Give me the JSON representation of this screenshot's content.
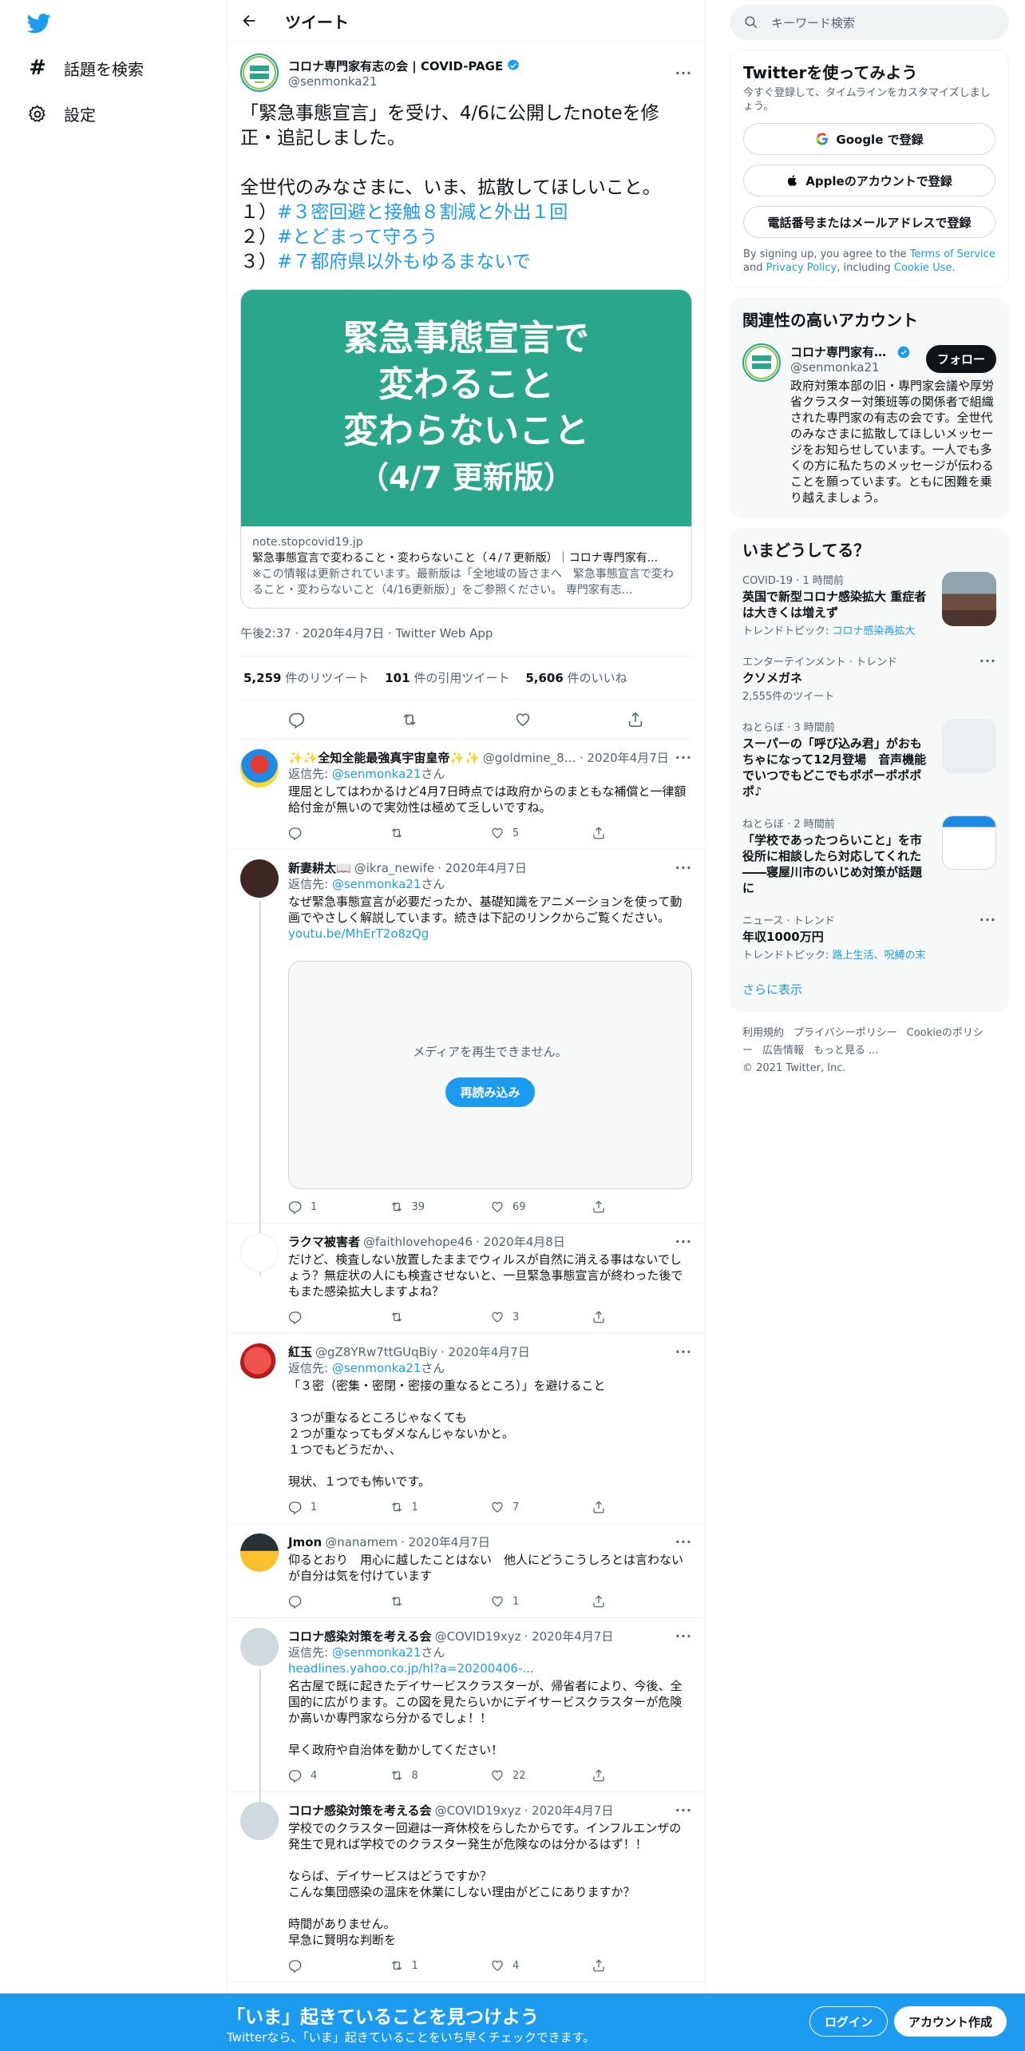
{
  "nav": {
    "explore_label": "話題を検索",
    "settings_label": "設定"
  },
  "header": {
    "title": "ツイート"
  },
  "main_tweet": {
    "author_name": "コロナ専門家有志の会 | COVID-PAGE",
    "handle": "@senmonka21",
    "avatar_text": "コロナ専門家",
    "text_intro": "「緊急事態宣言」を受け、4/6に公開したnoteを修正・追記しました。\n\n全世代のみなさまに、いま、拡散してほしいこと。\n",
    "points": [
      {
        "num": "１）",
        "tag": "#３密回避と接触８割減と外出１回"
      },
      {
        "num": "２）",
        "tag": "#とどまって守ろう"
      },
      {
        "num": "３）",
        "tag": "#７都府県以外もゆるまないで"
      }
    ],
    "card": {
      "image_line1": "緊急事態宣言で",
      "image_line2": "変わること",
      "image_line3": "変わらないこと",
      "image_line4": "（4/7 更新版）",
      "domain": "note.stopcovid19.jp",
      "title": "緊急事態宣言で変わること・変わらないこと（４/７更新版）｜コロナ専門家有...",
      "description": "※この情報は更新されています。最新版は「全地域の皆さまへ　緊急事態宣言で変わること・変わらないこと（4/16更新版）」をご参照ください。 専門家有志..."
    },
    "meta": "午後2:37 · 2020年4月7日 · Twitter Web App",
    "stats": {
      "retweets": "5,259",
      "retweets_label": "件のリツイート",
      "quotes": "101",
      "quotes_label": "件の引用ツイート",
      "likes": "5,606",
      "likes_label": "件のいいね"
    }
  },
  "replies": [
    {
      "name": "✨✨全知全能最強真宇宙皇帝✨✨",
      "handle": "@goldmine_88...",
      "date": "· 2020年4月7日",
      "reply_to_prefix": "返信先: ",
      "reply_to": "@senmonka21",
      "reply_to_suffix": "さん",
      "text": "理屈としてはわかるけど4月7日時点では政府からのまともな補償と一律額給付金が無いので実効性は極めて乏しいですね。",
      "counts": {
        "reply": "",
        "retweet": "",
        "like": "5"
      }
    },
    {
      "name": "新妻耕太📖",
      "handle": "@ikra_newife",
      "date": "· 2020年4月7日",
      "reply_to_prefix": "返信先: ",
      "reply_to": "@senmonka21",
      "reply_to_suffix": "さん",
      "text": "なぜ緊急事態宣言が必要だったか、基礎知識をアニメーションを使って動画でやさしく解説しています。続きは下記のリンクからご覧ください。",
      "link": "youtu.be/MhErT2o8zQg",
      "media_message": "メディアを再生できません。",
      "media_reload": "再読み込み",
      "counts": {
        "reply": "1",
        "retweet": "39",
        "like": "69"
      }
    },
    {
      "name": "ラクマ被害者",
      "handle": "@faithlovehope46",
      "date": "· 2020年4月8日",
      "text": "だけど、検査しない放置したままでウィルスが自然に消える事はないでしょう？無症状の人にも検査させないと、一旦緊急事態宣言が終わった後でもまた感染拡大しますよね？",
      "counts": {
        "reply": "",
        "retweet": "",
        "like": "3"
      }
    },
    {
      "name": "紅玉",
      "handle": "@gZ8YRw7ttGUqBiy",
      "date": "· 2020年4月7日",
      "reply_to_prefix": "返信先: ",
      "reply_to": "@senmonka21",
      "reply_to_suffix": "さん",
      "text": "「３密（密集・密閉・密接の重なるところ）」を避けること\n\n３つが重なるところじゃなくても\n２つが重なってもダメなんじゃないかと。\n１つでもどうだか、、\n\n現状、１つでも怖いです。",
      "counts": {
        "reply": "1",
        "retweet": "1",
        "like": "7"
      }
    },
    {
      "name": "Jmon",
      "handle": "@nanamem",
      "date": "· 2020年4月7日",
      "text": "仰るとおり　用心に越したことはない　他人にどうこうしろとは言わないが自分は気を付けています",
      "counts": {
        "reply": "",
        "retweet": "",
        "like": "1"
      }
    },
    {
      "name": "コロナ感染対策を考える会",
      "handle": "@COVID19xyz",
      "date": "· 2020年4月7日",
      "reply_to_prefix": "返信先: ",
      "reply_to": "@senmonka21",
      "reply_to_suffix": "さん",
      "link": "headlines.yahoo.co.jp/hl?a=20200406-...",
      "text": "名古屋で既に起きたデイサービスクラスターが、帰省者により、今後、全国的に広がります。この図を見たらいかにデイサービスクラスターが危険か高いか専門家なら分かるでしょ！！\n\n早く政府や自治体を動かしてください！",
      "counts": {
        "reply": "4",
        "retweet": "8",
        "like": "22"
      }
    },
    {
      "name": "コロナ感染対策を考える会",
      "handle": "@COVID19xyz",
      "date": "· 2020年4月7日",
      "text": "学校でのクラスター回避は一斉休校をらしたからです。インフルエンザの発生で見れば学校でのクラスター発生が危険なのは分かるはず！！\n\nならば、デイサービスはどうですか？\nこんな集団感染の温床を休業にしない理由がどこにありますか？\n\n時間がありません。\n早急に賢明な判断を",
      "counts": {
        "reply": "",
        "retweet": "1",
        "like": "4"
      }
    }
  ],
  "right": {
    "search_placeholder": "キーワード検索",
    "signup": {
      "title": "Twitterを使ってみよう",
      "subtitle": "今すぐ登録して、タイムラインをカスタマイズしましょう。",
      "google": "Google で登録",
      "apple": "Appleのアカウントで登録",
      "phone": "電話番号またはメールアドレスで登録",
      "terms_1": "By signing up, you agree to the ",
      "terms_link1": "Terms of Service",
      "terms_2": " and ",
      "terms_link2": "Privacy Policy",
      "terms_3": ", including ",
      "terms_link3": "Cookie Use",
      "terms_4": "."
    },
    "relevant": {
      "title": "関連性の高いアカウント",
      "name": "コロナ専門家有志...",
      "handle": "@senmonka21",
      "follow": "フォロー",
      "bio": "政府対策本部の旧・専門家会議や厚労省クラスター対策班等の関係者で組織された専門家の有志の会です。全世代のみなさまに拡散してほしいメッセージをお知らせしています。一人でも多くの方に私たちのメッセージが伝わることを願っています。ともに困難を乗り越えましょう。"
    },
    "trends": {
      "title": "いまどうしてる？",
      "items": [
        {
          "cat": "COVID-19 · 1 時間前",
          "title": "英国で新型コロナ感染拡大 重症者は大きくは増えず",
          "sub_prefix": "トレンドトピック: ",
          "sub_link": "コロナ感染再拡大",
          "thumb": "building"
        },
        {
          "cat": "エンターテインメント · トレンド",
          "title": "クソメガネ",
          "sub_plain": "2,555件のツイート"
        },
        {
          "cat": "ねとらぼ · 3 時間前",
          "title": "スーパーの「呼び込み君」がおもちゃになって12月登場　音声機能でいつでもどこでもポポーポポポポ♪",
          "thumb": "robot"
        },
        {
          "cat": "ねとらぼ · 2 時間前",
          "title": "「学校であったつらいこと」を市役所に相談したら対応してくれた――寝屋川市のいじめ対策が話題に",
          "thumb": "doc"
        },
        {
          "cat": "ニュース · トレンド",
          "title": "年収1000万円",
          "sub_prefix": "トレンドトピック: ",
          "sub_link": "路上生活、呪縛の末"
        }
      ],
      "show_more": "さらに表示"
    },
    "footer": {
      "links": [
        "利用規約",
        "プライバシーポリシー",
        "Cookieのポリシー",
        "広告情報",
        "もっと見る ..."
      ],
      "copyright": "© 2021 Twitter, Inc."
    }
  },
  "bottom": {
    "title": "「いま」起きていることを見つけよう",
    "subtitle": "Twitterなら、「いま」起きていることをいち早くチェックできます。",
    "login": "ログイン",
    "signup": "アカウント作成"
  },
  "colors": {
    "accent": "#1d9bf0",
    "card_bg": "#2aa68a",
    "bottom_bar": "#1d9bf0"
  }
}
